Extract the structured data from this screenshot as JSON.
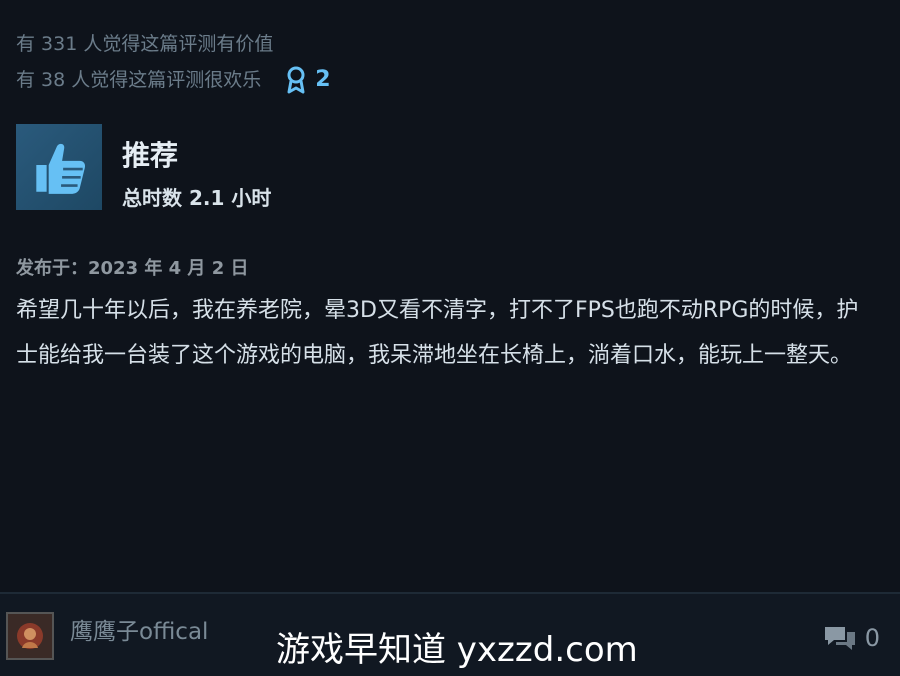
{
  "helpful": {
    "useful_text": "有 331 人觉得这篇评测有价值",
    "funny_text": "有 38 人觉得这篇评测很欢乐",
    "awards_count": "2"
  },
  "verdict": {
    "icon": "thumbs-up-icon",
    "label": "推荐",
    "hours": "总时数 2.1 小时"
  },
  "review": {
    "posted": "发布于：2023 年 4 月 2 日",
    "body": "希望几十年以后，我在养老院，晕3D又看不清字，打不了FPS也跑不动RPG的时候，护士能给我一台装了这个游戏的电脑，我呆滞地坐在长椅上，淌着口水，能玩上一整天。"
  },
  "footer": {
    "username": "鹰鹰子offical",
    "watermark": "游戏早知道 yxzzd.com",
    "comment_count": "0"
  },
  "colors": {
    "background": "#0e131b",
    "accent": "#66c0f4",
    "thumb_box": "#2a5a7c"
  }
}
